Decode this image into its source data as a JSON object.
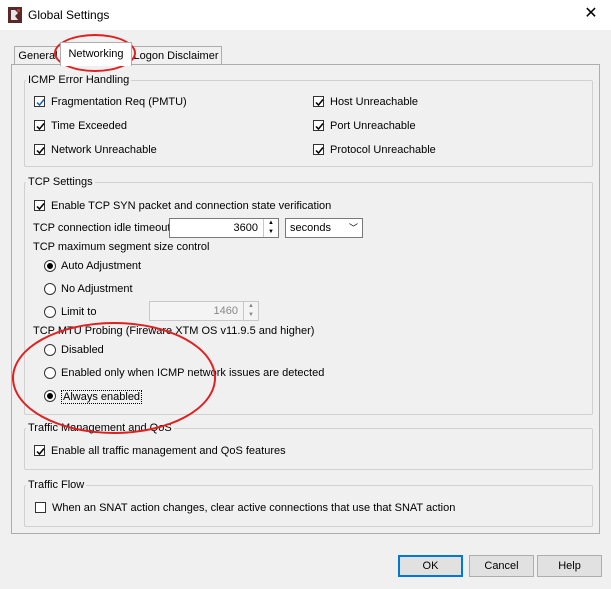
{
  "window": {
    "title": "Global Settings",
    "close_glyph": "✕",
    "icon": "app-logo-icon"
  },
  "tabs": [
    {
      "label": "General",
      "active": false
    },
    {
      "label": "Networking",
      "active": true
    },
    {
      "label": "Logon Disclaimer",
      "active": false
    }
  ],
  "icmp": {
    "title": "ICMP Error Handling",
    "items": [
      {
        "label": "Fragmentation Req (PMTU)",
        "checked": true
      },
      {
        "label": "Time Exceeded",
        "checked": true
      },
      {
        "label": "Network Unreachable",
        "checked": true
      },
      {
        "label": "Host Unreachable",
        "checked": true
      },
      {
        "label": "Port Unreachable",
        "checked": true
      },
      {
        "label": "Protocol Unreachable",
        "checked": true
      }
    ]
  },
  "tcp": {
    "title": "TCP Settings",
    "syn_label": "Enable TCP SYN packet and connection state verification",
    "syn_checked": true,
    "idle_label": "TCP connection idle timeout",
    "idle_value": "3600",
    "idle_unit": "seconds",
    "mss_label": "TCP maximum segment size control",
    "mss_options": [
      "Auto Adjustment",
      "No Adjustment",
      "Limit to"
    ],
    "mss_selected": 0,
    "limit_value": "1460",
    "mtu_label": "TCP MTU Probing (Fireware XTM OS v11.9.5 and higher)",
    "mtu_options": [
      "Disabled",
      "Enabled only when ICMP network issues are detected",
      "Always enabled"
    ],
    "mtu_selected": 2
  },
  "traffic": {
    "title": "Traffic Management and QoS",
    "label": "Enable all traffic management and QoS features",
    "checked": true
  },
  "flow": {
    "title": "Traffic Flow",
    "label": "When an SNAT action changes, clear active connections that use that SNAT action",
    "checked": false
  },
  "buttons": {
    "ok": "OK",
    "cancel": "Cancel",
    "help": "Help"
  },
  "colors": {
    "check": "#1a5fb4",
    "annotation": "#e02020",
    "default_button_border": "#0078d7"
  }
}
